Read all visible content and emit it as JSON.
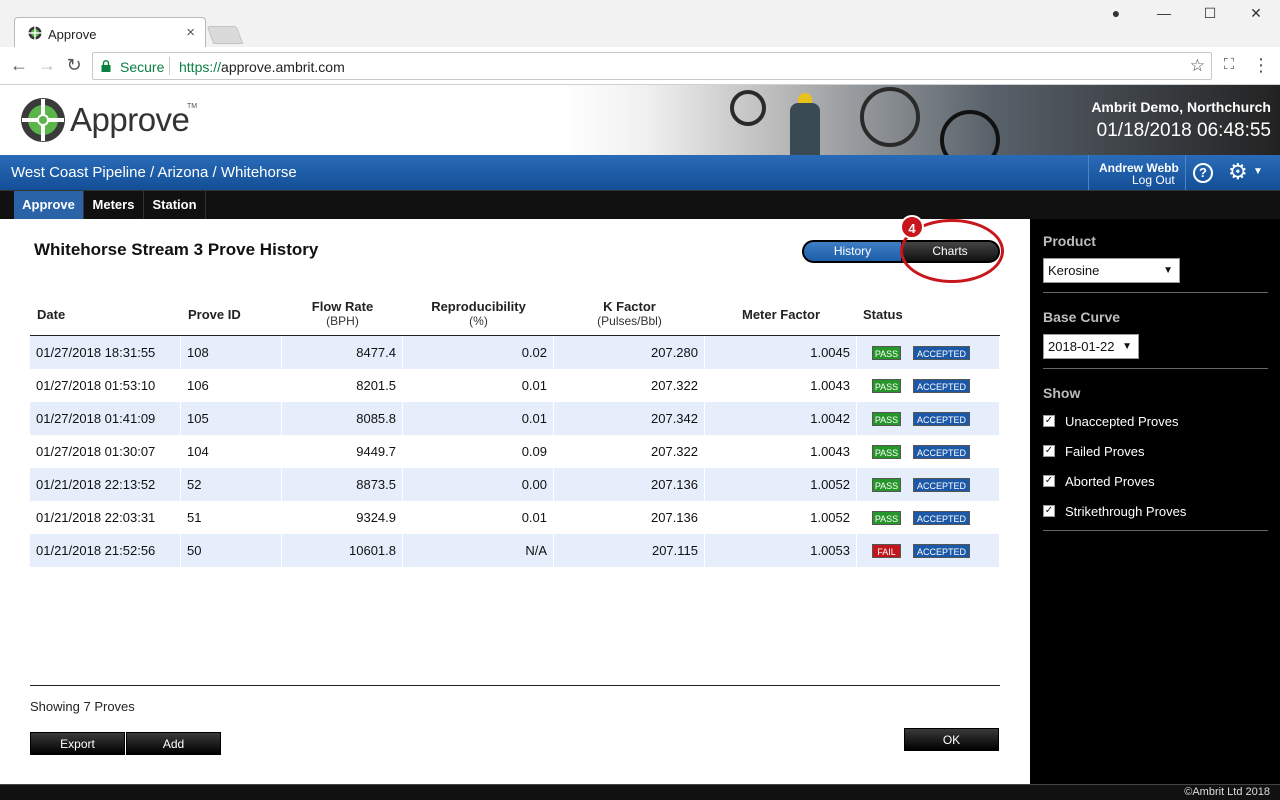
{
  "browser": {
    "tab_title": "Approve",
    "secure_label": "Secure",
    "url_scheme": "https://",
    "url_host": "approve.ambrit.com"
  },
  "header": {
    "logo_text": "Approve",
    "logo_tm": "TM",
    "company": "Ambrit Demo, Northchurch",
    "datetime": "01/18/2018 06:48:55"
  },
  "breadcrumb": "West Coast Pipeline / Arizona / Whitehorse",
  "user": {
    "name": "Andrew Webb",
    "logout": "Log Out"
  },
  "menu": {
    "approve": "Approve",
    "meters": "Meters",
    "station": "Station"
  },
  "page": {
    "title": "Whitehorse Stream 3 Prove History",
    "history_label": "History",
    "charts_label": "Charts",
    "annotation_number": "4"
  },
  "table": {
    "headers": {
      "date": "Date",
      "prove_id": "Prove ID",
      "flow_rate": "Flow Rate",
      "flow_rate_unit": "(BPH)",
      "reproducibility": "Reproducibility",
      "reproducibility_unit": "(%)",
      "k_factor": "K Factor",
      "k_factor_unit": "(Pulses/Bbl)",
      "meter_factor": "Meter Factor",
      "status": "Status"
    },
    "rows": [
      {
        "date": "01/27/2018 18:31:55",
        "id": "108",
        "flow": "8477.4",
        "rep": "0.02",
        "k": "207.280",
        "mf": "1.0045",
        "result": "PASS",
        "state": "ACCEPTED"
      },
      {
        "date": "01/27/2018 01:53:10",
        "id": "106",
        "flow": "8201.5",
        "rep": "0.01",
        "k": "207.322",
        "mf": "1.0043",
        "result": "PASS",
        "state": "ACCEPTED"
      },
      {
        "date": "01/27/2018 01:41:09",
        "id": "105",
        "flow": "8085.8",
        "rep": "0.01",
        "k": "207.342",
        "mf": "1.0042",
        "result": "PASS",
        "state": "ACCEPTED"
      },
      {
        "date": "01/27/2018 01:30:07",
        "id": "104",
        "flow": "9449.7",
        "rep": "0.09",
        "k": "207.322",
        "mf": "1.0043",
        "result": "PASS",
        "state": "ACCEPTED"
      },
      {
        "date": "01/21/2018 22:13:52",
        "id": "52",
        "flow": "8873.5",
        "rep": "0.00",
        "k": "207.136",
        "mf": "1.0052",
        "result": "PASS",
        "state": "ACCEPTED"
      },
      {
        "date": "01/21/2018 22:03:31",
        "id": "51",
        "flow": "9324.9",
        "rep": "0.01",
        "k": "207.136",
        "mf": "1.0052",
        "result": "PASS",
        "state": "ACCEPTED"
      },
      {
        "date": "01/21/2018 21:52:56",
        "id": "50",
        "flow": "10601.8",
        "rep": "N/A",
        "k": "207.115",
        "mf": "1.0053",
        "result": "FAIL",
        "state": "ACCEPTED"
      }
    ]
  },
  "footer": {
    "showing": "Showing 7 Proves",
    "export": "Export",
    "add": "Add",
    "ok": "OK"
  },
  "sidebar": {
    "product_label": "Product",
    "product_value": "Kerosine",
    "base_curve_label": "Base Curve",
    "base_curve_value": "2018-01-22",
    "show_label": "Show",
    "checks": [
      {
        "label": "Unaccepted Proves",
        "checked": true
      },
      {
        "label": "Failed Proves",
        "checked": true
      },
      {
        "label": "Aborted Proves",
        "checked": true
      },
      {
        "label": "Strikethrough Proves",
        "checked": true
      }
    ]
  },
  "copyright": "©Ambrit Ltd 2018",
  "colors": {
    "brand_blue": "#1d5ea8",
    "pass_green": "#27962a",
    "fail_red": "#c0161c",
    "annotation_red": "#c8161d"
  }
}
